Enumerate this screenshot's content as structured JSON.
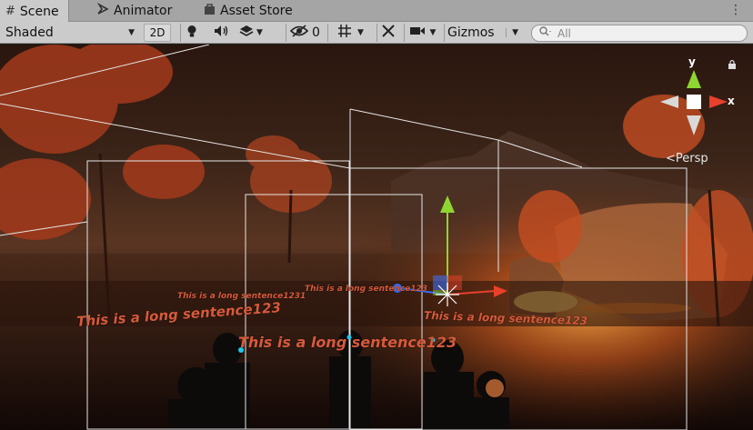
{
  "tabs": [
    {
      "label": "Scene",
      "icon": "grid-icon",
      "active": true
    },
    {
      "label": "Animator",
      "icon": "animator-icon",
      "active": false
    },
    {
      "label": "Asset Store",
      "icon": "store-bag-icon",
      "active": false
    }
  ],
  "toolbar": {
    "shading_mode": "Shaded",
    "mode_2d_label": "2D",
    "hidden_count": "0",
    "gizmos_label": "Gizmos",
    "search_placeholder": "All"
  },
  "scene": {
    "world_texts": [
      "This is a long sentence1231",
      "This is a long sentence123",
      "This is a long sentence123",
      "This is a long sentence123",
      "This is a long sentence123"
    ],
    "orientation_gizmo": {
      "y_label": "y",
      "x_label": "x",
      "projection_label": "Persp"
    },
    "colors": {
      "text_color": "#d65a3c",
      "axis_x": "#e8402a",
      "axis_y": "#8ed531",
      "axis_z": "#3b6cf2",
      "handle_cyan": "#20c8e8"
    }
  }
}
